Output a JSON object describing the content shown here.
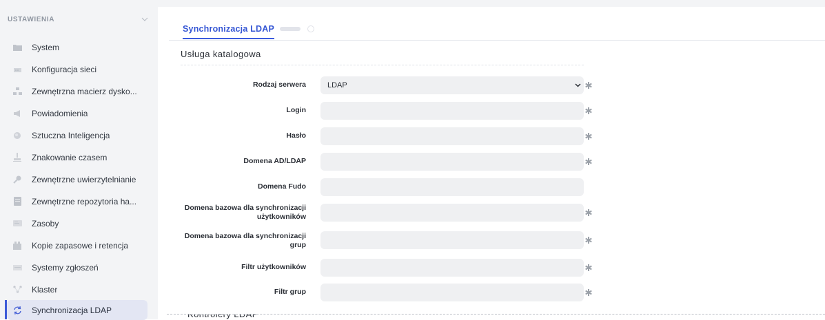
{
  "sidebar": {
    "title": "USTAWIENIA",
    "items": [
      {
        "label": "System",
        "icon": "folder-icon"
      },
      {
        "label": "Konfiguracja sieci",
        "icon": "network-icon"
      },
      {
        "label": "Zewnętrzna macierz dysko...",
        "icon": "storage-icon"
      },
      {
        "label": "Powiadomienia",
        "icon": "megaphone-icon"
      },
      {
        "label": "Sztuczna Inteligencja",
        "icon": "brain-icon"
      },
      {
        "label": "Znakowanie czasem",
        "icon": "stamp-icon"
      },
      {
        "label": "Zewnętrzne uwierzytelnianie",
        "icon": "key-icon"
      },
      {
        "label": "Zewnętrzne repozytoria ha...",
        "icon": "vault-icon"
      },
      {
        "label": "Zasoby",
        "icon": "resources-icon"
      },
      {
        "label": "Kopie zapasowe i retencja",
        "icon": "backup-icon"
      },
      {
        "label": "Systemy zgłoszeń",
        "icon": "tickets-icon"
      },
      {
        "label": "Klaster",
        "icon": "cluster-icon"
      },
      {
        "label": "Synchronizacja LDAP",
        "icon": "sync-icon",
        "active": true
      }
    ]
  },
  "tabs": {
    "active_label": "Synchronizacja LDAP"
  },
  "section": {
    "title": "Usługa katalogowa"
  },
  "form": {
    "server_type": {
      "label": "Rodzaj serwera",
      "value": "LDAP"
    },
    "login": {
      "label": "Login",
      "value": ""
    },
    "password": {
      "label": "Hasło",
      "value": ""
    },
    "ad_domain": {
      "label": "Domena AD/LDAP",
      "value": ""
    },
    "fudo_domain": {
      "label": "Domena Fudo",
      "value": ""
    },
    "user_base_domain": {
      "label_line1": "Domena bazowa dla synchronizacji",
      "label_line2": "użytkowników",
      "value": ""
    },
    "group_base_domain": {
      "label_line1": "Domena bazowa dla synchronizacji",
      "label_line2": "grup",
      "value": ""
    },
    "user_filter": {
      "label": "Filtr użytkowników",
      "value": ""
    },
    "group_filter": {
      "label": "Filtr grup",
      "value": ""
    }
  },
  "bottom_section": {
    "title": "Kontrolery LDAP"
  },
  "colors": {
    "accent": "#3a5bde",
    "sidebar_bg": "#f3f4f6",
    "field_bg": "#eff0f2",
    "required": "#9aa0a8"
  }
}
